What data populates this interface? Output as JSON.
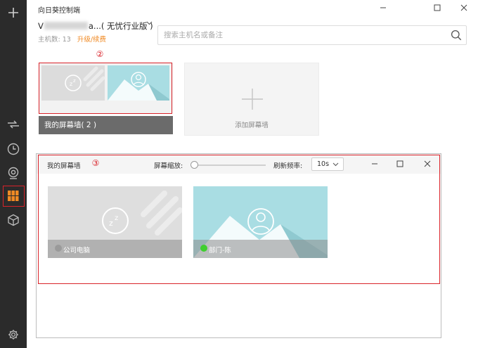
{
  "app": {
    "title": "向日葵控制端"
  },
  "account": {
    "name_prefix": "V",
    "name_suffix": "a...( 无忧行业版 )",
    "host_count_label": "主机数:",
    "host_count": "13",
    "upgrade_link": "升级/续费"
  },
  "search": {
    "placeholder": "搜索主机名或备注"
  },
  "markers": {
    "one": "①",
    "two": "②",
    "three": "③"
  },
  "walls": {
    "my_wall_label": "我的屏幕墙( 2 )",
    "add_wall_label": "添加屏幕墙"
  },
  "wall_window": {
    "title": "我的屏幕墙",
    "zoom_label": "屏幕缩放:",
    "zoom_level": 0.0,
    "refresh_label": "刷新频率:",
    "refresh_value": "10s",
    "devices": [
      {
        "name": "公司电脑",
        "status_color": "#9a9a9a",
        "state": "offline"
      },
      {
        "name": "部门-陈",
        "status_color": "#3fcf2f",
        "state": "online"
      }
    ]
  },
  "colors": {
    "sidebar_bg": "#2b2b2b",
    "accent_orange": "#f08a24",
    "annotation_red": "#d9232a",
    "online_green": "#3fcf2f",
    "preview_blue": "#a9dde3"
  },
  "icons": {
    "sidebar": [
      "plus-icon",
      "remote-transfer-icon",
      "clock-icon",
      "camera-icon",
      "screen-wall-icon",
      "cube-icon",
      "gear-icon"
    ],
    "window": [
      "minimize-icon",
      "maximize-icon",
      "close-icon"
    ],
    "search": "search-icon"
  }
}
